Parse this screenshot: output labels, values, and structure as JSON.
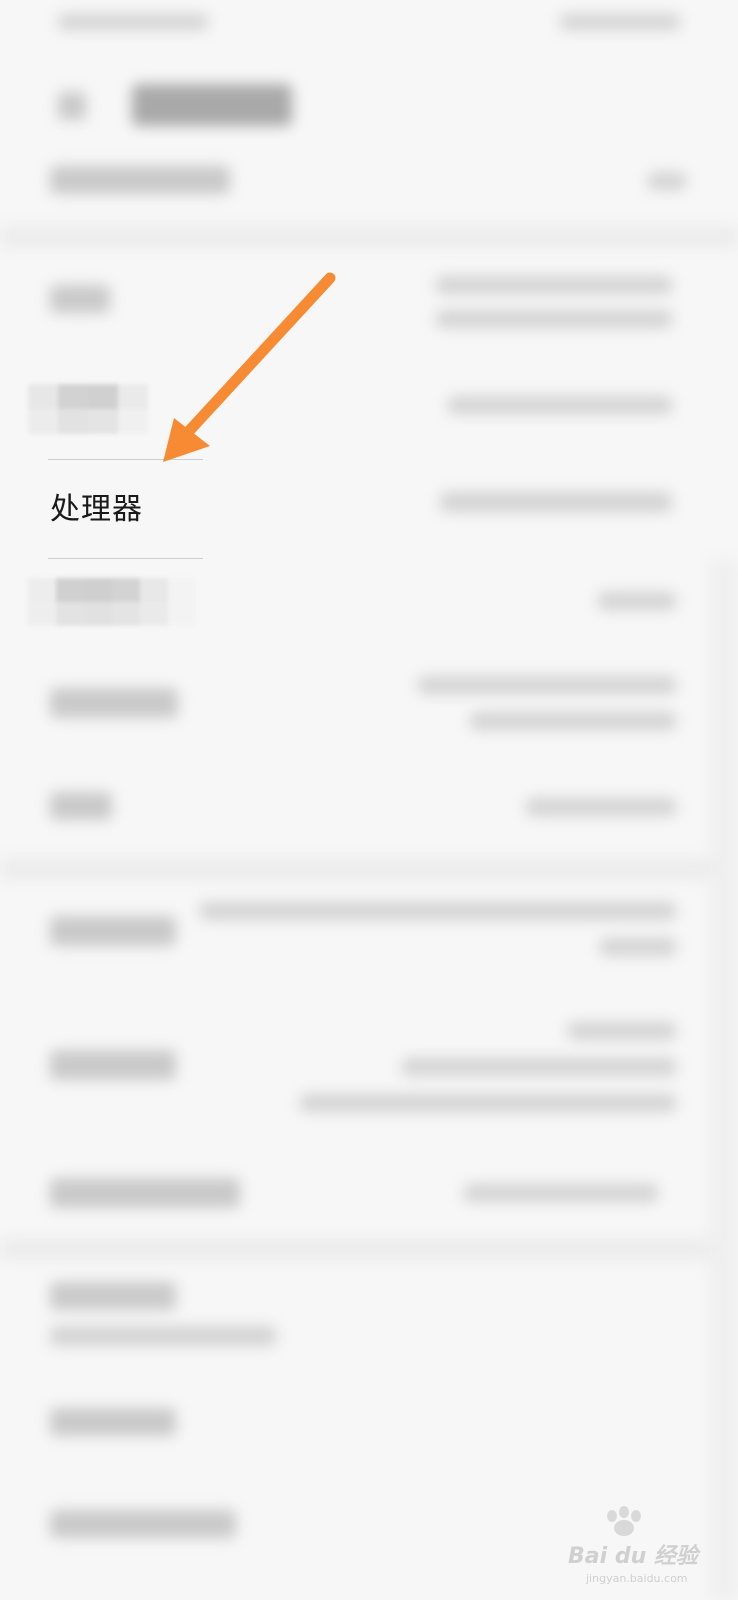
{
  "row": {
    "label": "处理器"
  },
  "annotation": {
    "arrow_color": "#F68B33"
  },
  "watermark": {
    "text": "Bai du 经验",
    "url": "jingyan.baidu.com"
  },
  "colors": {
    "background": "#F7F7F7",
    "text": "#1A1A1A"
  }
}
